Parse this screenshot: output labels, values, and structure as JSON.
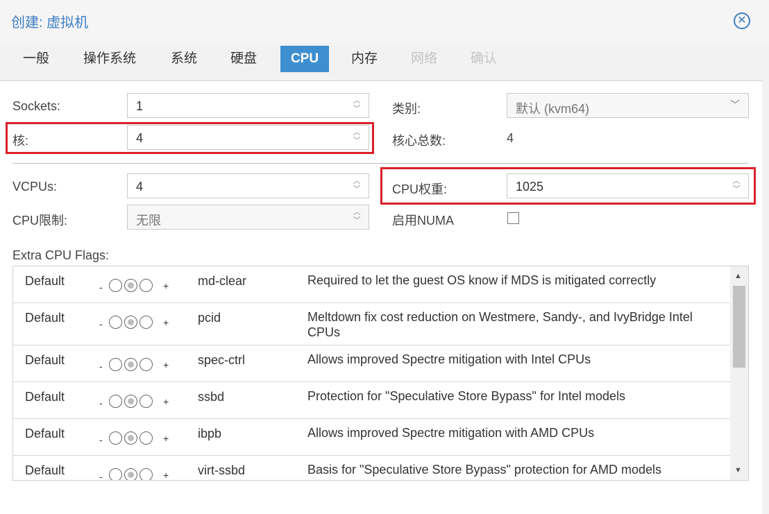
{
  "window": {
    "title": "创建: 虚拟机",
    "close_glyph": "✕"
  },
  "tabs": [
    {
      "label": "一般",
      "state": "normal"
    },
    {
      "label": "操作系统",
      "state": "normal"
    },
    {
      "label": "系统",
      "state": "normal"
    },
    {
      "label": "硬盘",
      "state": "normal"
    },
    {
      "label": "CPU",
      "state": "active"
    },
    {
      "label": "内存",
      "state": "normal"
    },
    {
      "label": "网络",
      "state": "disabled"
    },
    {
      "label": "确认",
      "state": "disabled"
    }
  ],
  "form": {
    "sockets": {
      "label": "Sockets:",
      "value": "1"
    },
    "cores": {
      "label": "核:",
      "value": "4"
    },
    "type": {
      "label": "类别:",
      "value": "默认 (kvm64)"
    },
    "total_cores": {
      "label": "核心总数:",
      "value": "4"
    },
    "vcpus": {
      "label": "VCPUs:",
      "value": "4"
    },
    "cpu_limit": {
      "label": "CPU限制:",
      "value": "无限"
    },
    "cpu_weight": {
      "label": "CPU权重:",
      "value": "1025"
    },
    "numa": {
      "label": "启用NUMA",
      "checked": false
    }
  },
  "flags": {
    "label": "Extra CPU Flags:",
    "rows": [
      {
        "state": "Default",
        "name": "md-clear",
        "desc": "Required to let the guest OS know if MDS is mitigated correctly"
      },
      {
        "state": "Default",
        "name": "pcid",
        "desc": "Meltdown fix cost reduction on Westmere, Sandy-, and IvyBridge Intel CPUs"
      },
      {
        "state": "Default",
        "name": "spec-ctrl",
        "desc": "Allows improved Spectre mitigation with Intel CPUs"
      },
      {
        "state": "Default",
        "name": "ssbd",
        "desc": "Protection for \"Speculative Store Bypass\" for Intel models"
      },
      {
        "state": "Default",
        "name": "ibpb",
        "desc": "Allows improved Spectre mitigation with AMD CPUs"
      },
      {
        "state": "Default",
        "name": "virt-ssbd",
        "desc": "Basis for \"Speculative Store Bypass\" protection for AMD models"
      }
    ],
    "minus_glyph": "-",
    "plus_glyph": "+"
  },
  "colors": {
    "accent": "#3d8fd0",
    "highlight": "#d9202a"
  }
}
